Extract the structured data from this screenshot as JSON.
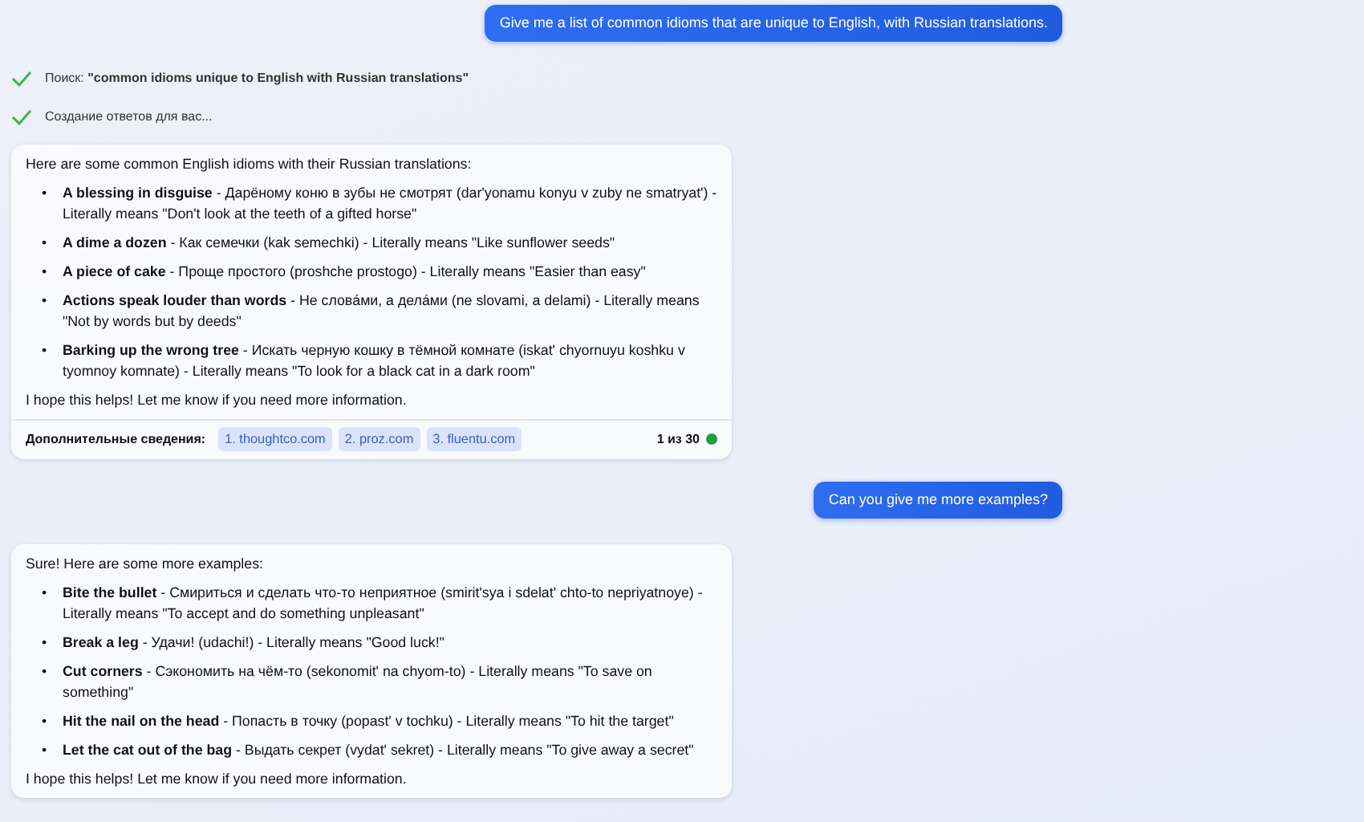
{
  "messages": [
    {
      "kind": "user",
      "text": "Give me a list of common idioms that are unique to English, with Russian translations."
    },
    {
      "kind": "step",
      "text": "Поиск: **\"common idioms unique to English with Russian translations\"**"
    },
    {
      "kind": "step",
      "text": "Создание ответов для вас..."
    },
    {
      "kind": "answer",
      "intro": "Here are some common English idioms with their Russian translations:",
      "items": [
        {
          "bullet": "•",
          "text": "**A blessing in disguise** - Дарёному коню в зубы не смотрят (dar'yonamu konyu v zuby ne smatryat') - Literally means \"Don't look at the teeth of a gifted horse\""
        },
        {
          "bullet": "•",
          "text": "**A dime a dozen** - Как семечки (kak semechki) - Literally means \"Like sunflower seeds\""
        },
        {
          "bullet": "•",
          "text": "**A piece of cake** - Проще простого (proshche prostogo) - Literally means \"Easier than easy\""
        },
        {
          "bullet": "•",
          "text": "**Actions speak louder than words** - Не словáми, а делáми (ne slovami, a delami) - Literally means \"Not by words but by deeds\""
        },
        {
          "bullet": "•",
          "text": "**Barking up the wrong tree** - Искать черную кошку в тёмной комнате (iskat' chyornuyu koshku v tyomnoy komnate) - Literally means \"To look for a black cat in a dark room\""
        }
      ],
      "outro": "I hope this helps! Let me know if you need more information.",
      "footer": {
        "label": "Дополнительные сведения:",
        "links": [
          "1. thoughtco.com",
          "2. proz.com",
          "3. fluentu.com"
        ],
        "count": "1 из 30"
      }
    },
    {
      "kind": "user",
      "text": "Can you give me more examples?"
    },
    {
      "kind": "answer",
      "intro": "Sure! Here are some more examples:",
      "items": [
        {
          "bullet": "•",
          "text": "**Bite the bullet** - Смириться и сделать что-то неприятное (smirit'sya i sdelat' chto-to nepriyatnoye) - Literally means \"To accept and do something unpleasant\""
        },
        {
          "bullet": "•",
          "text": "**Break a leg** - Удачи! (udachi!) - Literally means \"Good luck!\""
        },
        {
          "bullet": "•",
          "text": "**Cut corners** - Сэкономить на чём-то (sekonomit' na chyom-to) - Literally means \"To save on something\""
        },
        {
          "bullet": "•",
          "text": "**Hit the nail on the head** - Попасть в точку (popast' v tochku) - Literally means \"To hit the target\""
        },
        {
          "bullet": "•",
          "text": "**Let the cat out of the bag** - Выдать секрет (vydat' sekret) - Literally means \"To give away a secret\""
        }
      ],
      "outro": "I hope this helps! Let me know if you need more information."
    }
  ]
}
